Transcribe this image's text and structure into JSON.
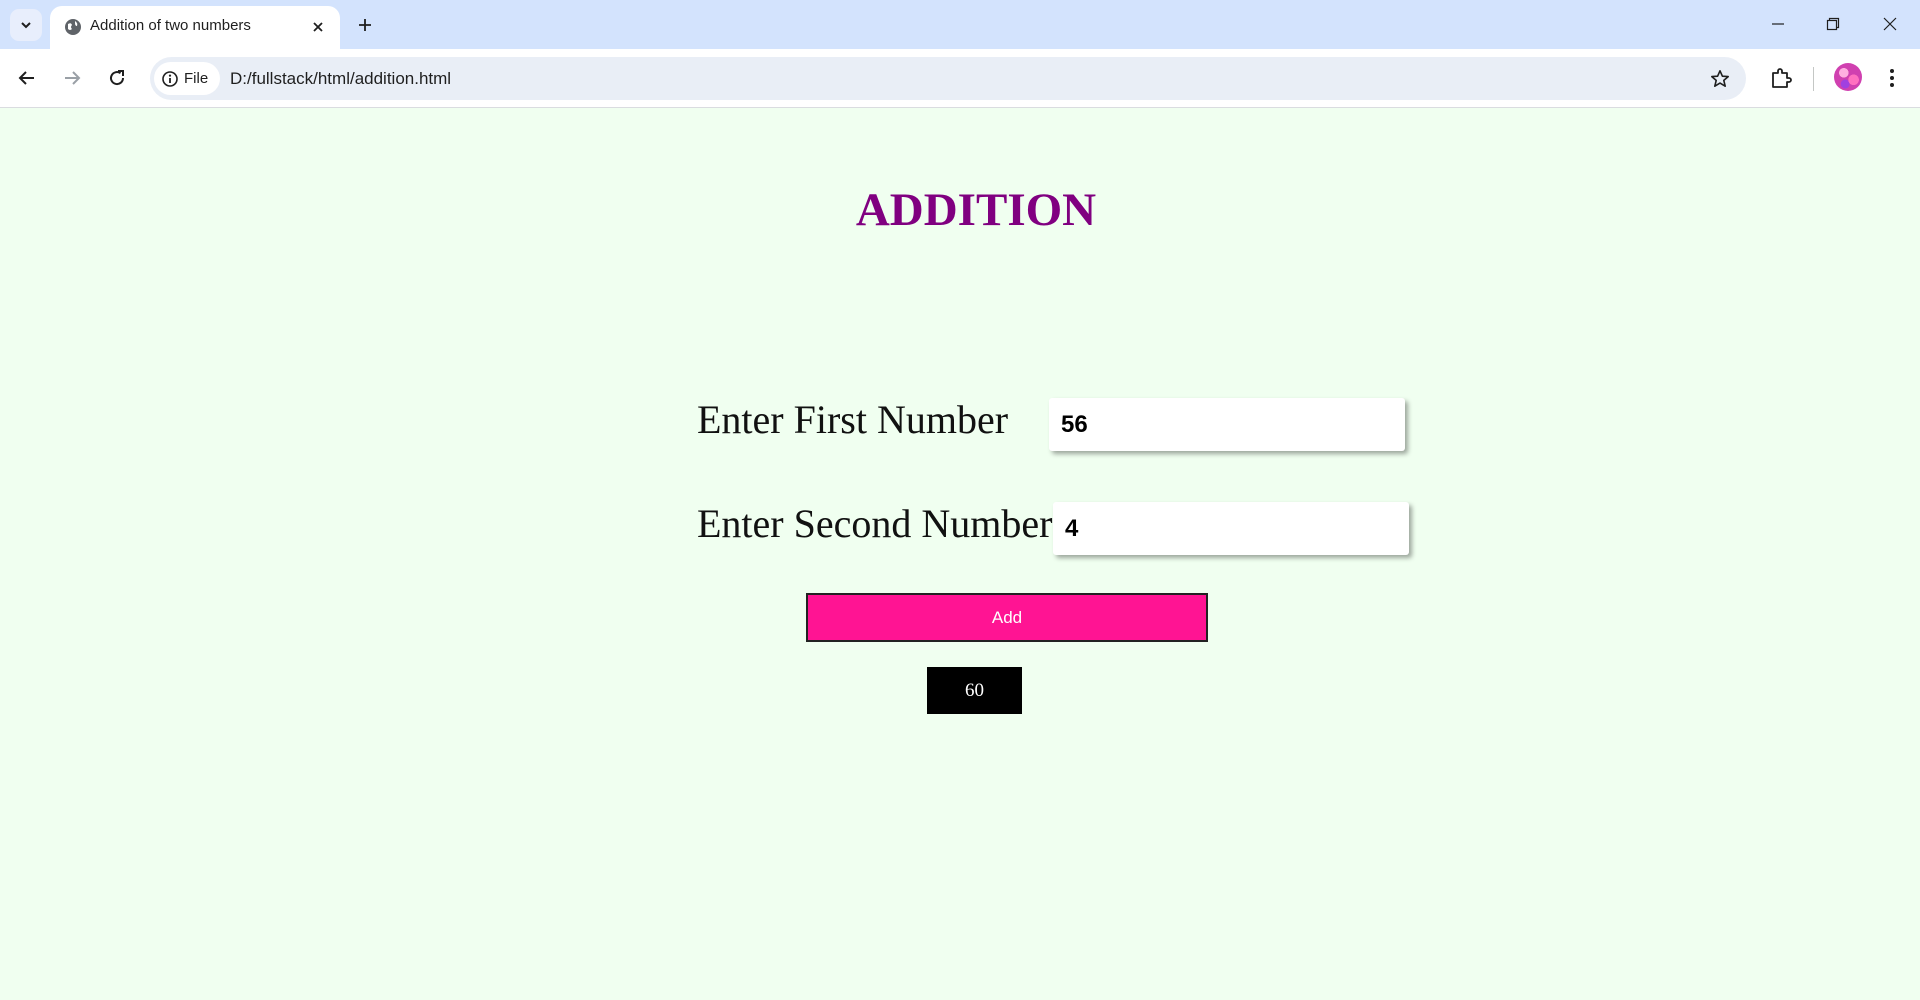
{
  "browser": {
    "tab_title": "Addition of two numbers",
    "url_chip_label": "File",
    "url": "D:/fullstack/html/addition.html"
  },
  "icons": {
    "tab_search": "chevron-down-icon",
    "favicon": "globe-icon",
    "tab_close": "close-icon",
    "new_tab": "plus-icon",
    "back": "arrow-left-icon",
    "forward": "arrow-right-icon",
    "reload": "reload-icon",
    "site_info": "info-icon",
    "bookmark": "star-icon",
    "extensions": "puzzle-icon",
    "menu": "kebab-menu-icon"
  },
  "page": {
    "heading": "ADDITION",
    "first_label": "Enter First Number",
    "first_value": "56",
    "second_label": "Enter Second Number",
    "second_value": "4",
    "add_label": "Add",
    "result": "60"
  },
  "colors": {
    "background": "#f0fff0",
    "heading": "#800080",
    "add_button": "#ff1493",
    "result_box": "#000000"
  }
}
